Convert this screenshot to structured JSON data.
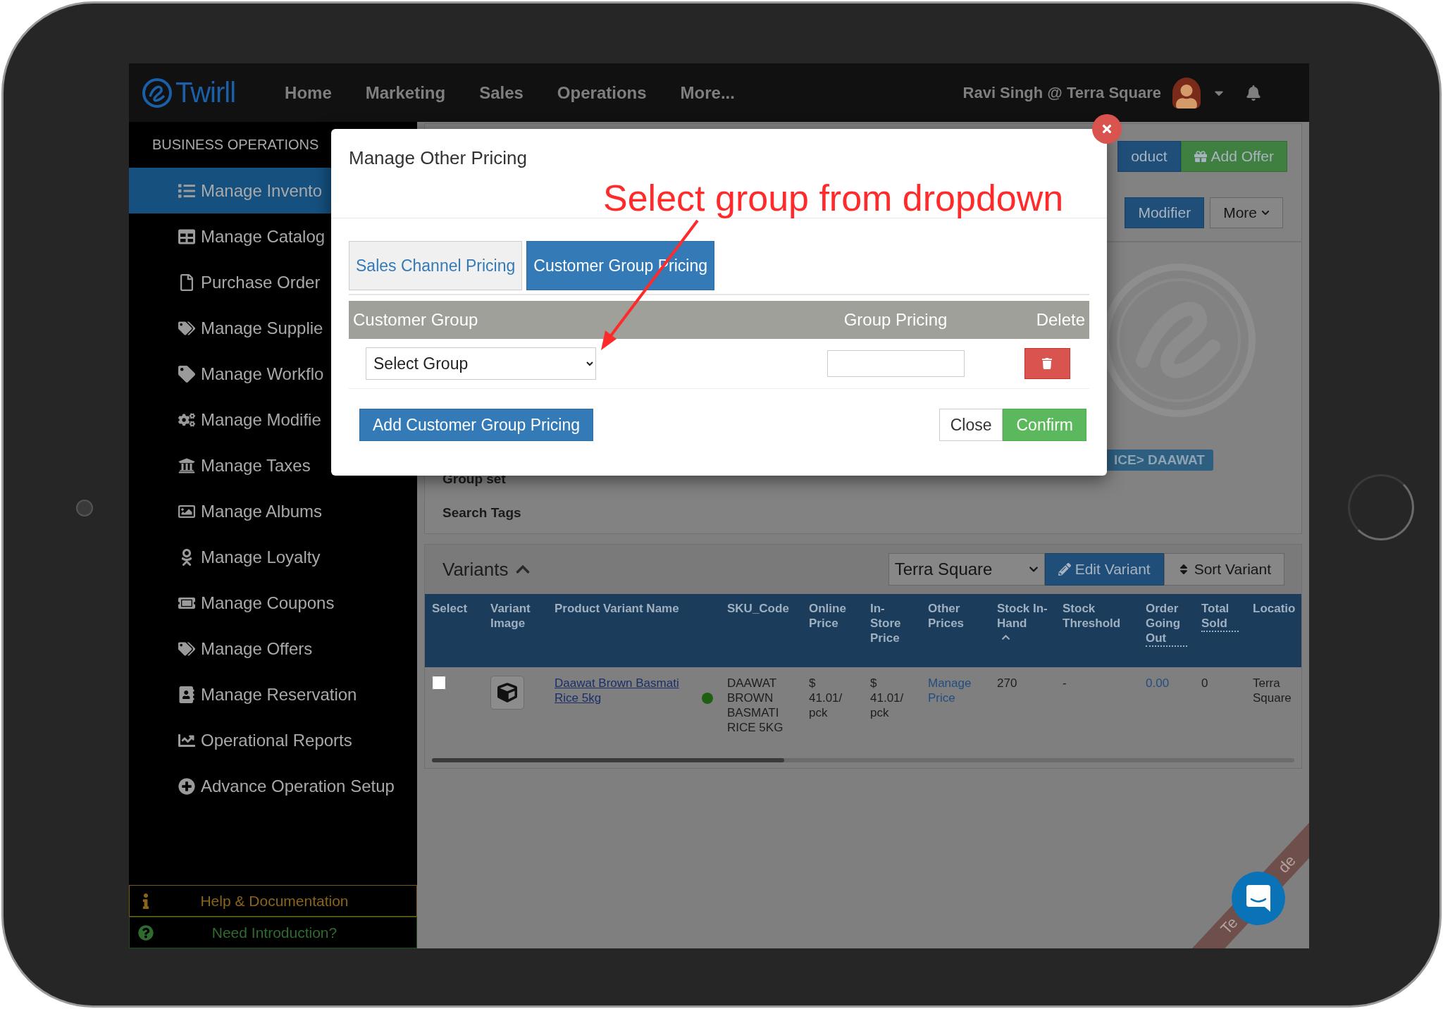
{
  "navbar": {
    "logo": "Twirll",
    "links": [
      {
        "label": "Home"
      },
      {
        "label": "Marketing"
      },
      {
        "label": "Sales"
      },
      {
        "label": "Operations"
      },
      {
        "label": "More..."
      }
    ],
    "user": "Ravi Singh @ Terra Square"
  },
  "sidebar": {
    "title": "BUSINESS OPERATIONS",
    "items": [
      {
        "label": "Manage Invento",
        "selected": true
      },
      {
        "label": "Manage Catalog",
        "selected": false
      },
      {
        "label": "Purchase Order",
        "selected": false
      },
      {
        "label": "Manage Supplie",
        "selected": false
      },
      {
        "label": "Manage Workflo",
        "selected": false
      },
      {
        "label": "Manage Modifie",
        "selected": false
      },
      {
        "label": "Manage Taxes",
        "selected": false
      },
      {
        "label": "Manage Albums",
        "selected": false
      },
      {
        "label": "Manage Loyalty",
        "selected": false
      },
      {
        "label": "Manage Coupons",
        "selected": false
      },
      {
        "label": "Manage Offers",
        "selected": false
      },
      {
        "label": "Manage Reservation",
        "selected": false
      },
      {
        "label": "Operational Reports",
        "selected": false
      },
      {
        "label": "Advance Operation Setup",
        "selected": false
      }
    ],
    "help": "Help & Documentation",
    "intro": "Need Introduction?"
  },
  "page": {
    "toolbar": [
      {
        "label": "oduct",
        "kind": "primary"
      },
      {
        "label": "Add Offer",
        "kind": "success"
      }
    ],
    "toolbar_2": [
      {
        "label": "Modifier",
        "kind": "primary"
      },
      {
        "label": "More",
        "kind": "default"
      }
    ],
    "fields": [
      "Group set",
      "Search Tags"
    ],
    "tag": "ICE> DAAWAT"
  },
  "variants": {
    "title": "Variants",
    "location": "Terra Square",
    "buttons": [
      {
        "label": "Edit Variant",
        "kind": "primary"
      },
      {
        "label": "Sort Variant",
        "kind": "default"
      }
    ],
    "columns": [
      {
        "label": "Select",
        "kind": "plain"
      },
      {
        "label": "Variant Image",
        "kind": "plain"
      },
      {
        "label": "Product Variant Name",
        "kind": "plain"
      },
      {
        "label": "SKU_Code",
        "kind": "plain"
      },
      {
        "label": "Online Price",
        "kind": "plain"
      },
      {
        "label": "In-Store Price",
        "kind": "plain"
      },
      {
        "label": "Other Prices",
        "kind": "plain"
      },
      {
        "label": "Stock In-Hand",
        "kind": "sorted"
      },
      {
        "label": "Stock Threshold",
        "kind": "plain"
      },
      {
        "label": "Order Going Out",
        "kind": "abbr"
      },
      {
        "label": "Total Sold",
        "kind": "abbr"
      },
      {
        "label": "Locatio",
        "kind": "plain"
      }
    ],
    "rows": [
      {
        "selected": false,
        "name": "Daawat Brown Basmati Rice 5kg",
        "sku": "DAAWAT BROWN BASMATI RICE 5KG",
        "online_price": "$ 41.01/ pck",
        "instore_price": "$ 41.01/ pck",
        "other_prices": "Manage Price",
        "stock": "270",
        "threshold": "-",
        "order_going_out": "0.00",
        "total_sold": "0",
        "location": "Terra Square"
      }
    ]
  },
  "modal": {
    "title": "Manage Other Pricing",
    "tabs": [
      {
        "label": "Sales Channel Pricing",
        "selected": false
      },
      {
        "label": "Customer Group Pricing",
        "selected": true
      }
    ],
    "columns": [
      "Customer Group",
      "Group Pricing",
      "Delete"
    ],
    "rows": [
      {
        "group": "Select Group"
      }
    ],
    "add_button": "Add Customer Group Pricing",
    "close_button": "Close",
    "confirm_button": "Confirm"
  },
  "annotation": "Select group from dropdown",
  "ribbon": [
    "Te",
    "de"
  ]
}
